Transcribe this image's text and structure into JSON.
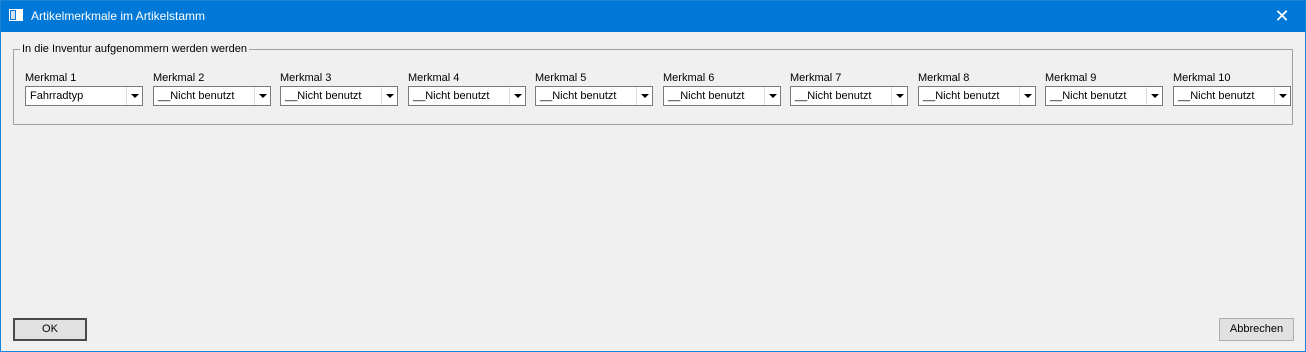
{
  "window": {
    "title": "Artikelmerkmale im Artikelstamm",
    "close_glyph": "✕"
  },
  "group": {
    "legend": "In die Inventur aufgenommern werden werden",
    "fields": [
      {
        "label": "Merkmal 1",
        "value": "Fahrradtyp"
      },
      {
        "label": "Merkmal 2",
        "value": "__Nicht benutzt"
      },
      {
        "label": "Merkmal 3",
        "value": "__Nicht benutzt"
      },
      {
        "label": "Merkmal 4",
        "value": "__Nicht benutzt"
      },
      {
        "label": "Merkmal 5",
        "value": "__Nicht benutzt"
      },
      {
        "label": "Merkmal 6",
        "value": "__Nicht benutzt"
      },
      {
        "label": "Merkmal 7",
        "value": "__Nicht benutzt"
      },
      {
        "label": "Merkmal 8",
        "value": "__Nicht benutzt"
      },
      {
        "label": "Merkmal 9",
        "value": "__Nicht benutzt"
      },
      {
        "label": "Merkmal 10",
        "value": "__Nicht benutzt"
      }
    ]
  },
  "buttons": {
    "ok": "OK",
    "cancel": "Abbrechen"
  }
}
